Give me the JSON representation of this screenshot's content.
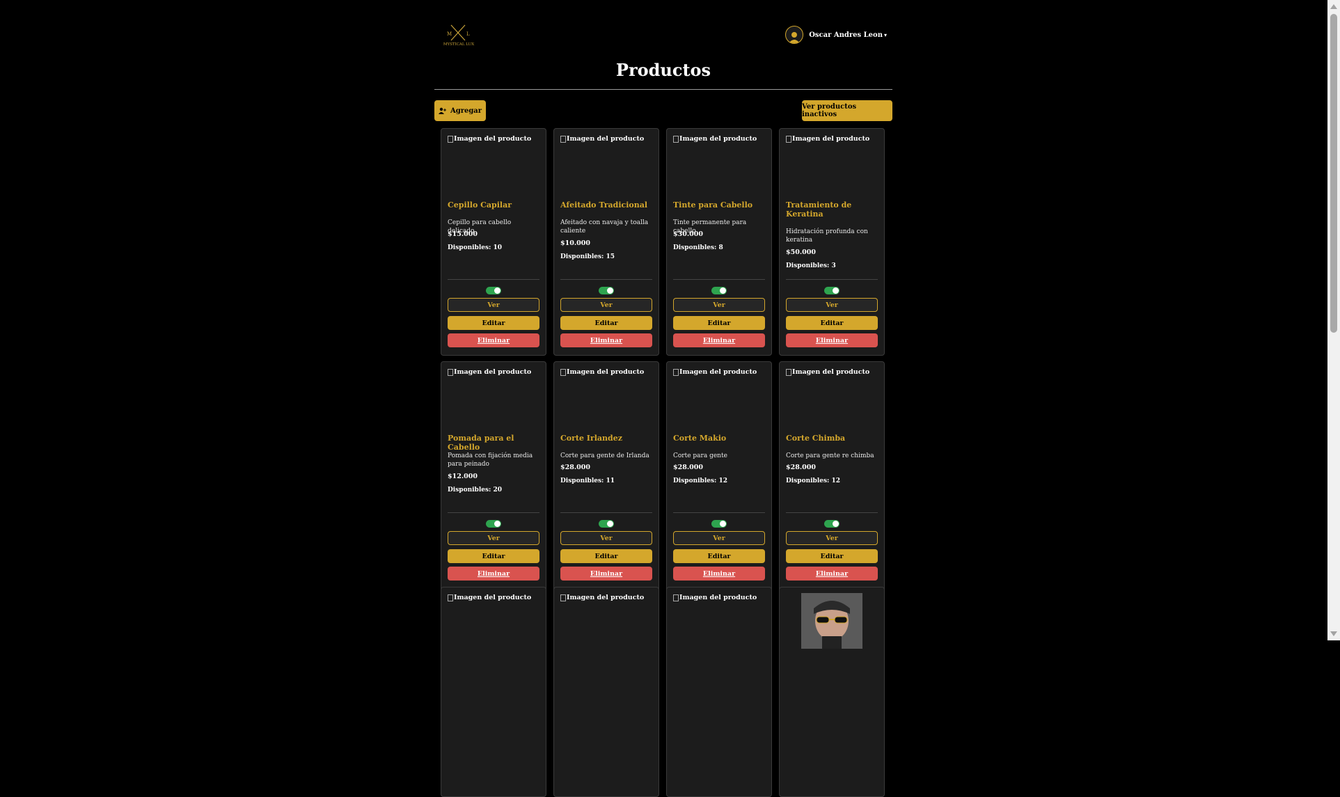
{
  "header": {
    "logo_text": "MYSTICAL LUX",
    "user_name": "Oscar Andres Leon",
    "user_caret": "▾"
  },
  "page": {
    "title": "Productos",
    "add_label": "Agregar",
    "inactive_label": "Ver productos inactivos"
  },
  "labels": {
    "img_alt": "Imagen del producto",
    "ver": "Ver",
    "editar": "Editar",
    "eliminar": "Eliminar"
  },
  "products": [
    {
      "name": "Cepillo Capilar",
      "desc": "Cepillo para cabello delicado",
      "price": "$15.000",
      "stock": "Disponibles: 10",
      "active": true
    },
    {
      "name": "Afeitado Tradicional",
      "desc": "Afeitado con navaja y toalla caliente",
      "price": "$10.000",
      "stock": "Disponibles: 15",
      "active": true
    },
    {
      "name": "Tinte para Cabello",
      "desc": "Tinte permanente para cabello",
      "price": "$30.000",
      "stock": "Disponibles: 8",
      "active": true
    },
    {
      "name": "Tratamiento de Keratina",
      "desc": "Hidratación profunda con keratina",
      "price": "$50.000",
      "stock": "Disponibles: 3",
      "active": true
    },
    {
      "name": "Pomada para el Cabello",
      "desc": "Pomada con fijación media para peinado",
      "price": "$12.000",
      "stock": "Disponibles: 20",
      "active": true
    },
    {
      "name": "Corte Irlandez",
      "desc": "Corte para gente de Irlanda",
      "price": "$28.000",
      "stock": "Disponibles: 11",
      "active": true
    },
    {
      "name": "Corte Makio",
      "desc": "Corte para gente",
      "price": "$28.000",
      "stock": "Disponibles: 12",
      "active": true
    },
    {
      "name": "Corte Chimba",
      "desc": "Corte para gente re chimba",
      "price": "$28.000",
      "stock": "Disponibles: 12",
      "active": true
    },
    {
      "name": "",
      "desc": "",
      "price": "",
      "stock": "",
      "active": true
    },
    {
      "name": "",
      "desc": "",
      "price": "",
      "stock": "",
      "active": true
    },
    {
      "name": "",
      "desc": "",
      "price": "",
      "stock": "",
      "active": true
    },
    {
      "name": "",
      "desc": "",
      "price": "",
      "stock": "",
      "active": true,
      "has_photo": true
    }
  ],
  "colors": {
    "accent": "#d4a72c",
    "danger": "#d9534f",
    "toggle_on": "#2ea44f",
    "card_bg": "#1c1c1c"
  }
}
